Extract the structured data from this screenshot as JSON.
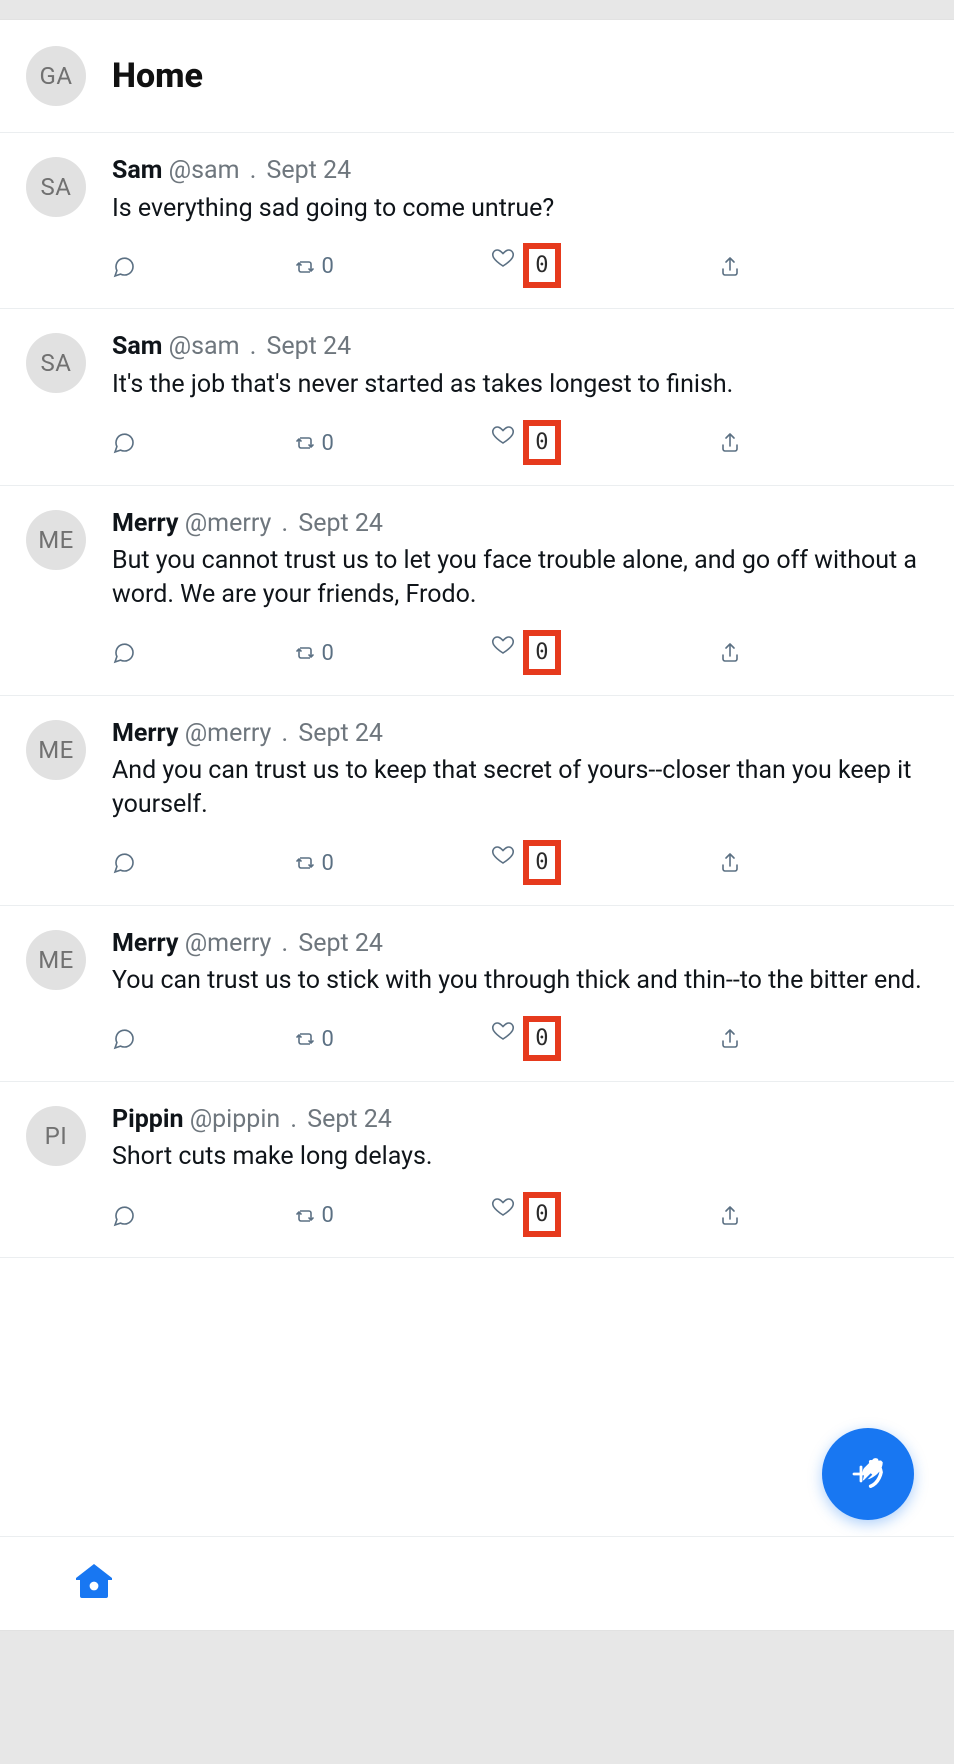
{
  "header": {
    "avatar_initials": "GA",
    "title": "Home"
  },
  "posts": [
    {
      "avatar": "SA",
      "name": "Sam",
      "handle": "@sam",
      "date": "Sept 24",
      "text": "Is everything sad going to come untrue?",
      "retweets": "0",
      "likes": "0"
    },
    {
      "avatar": "SA",
      "name": "Sam",
      "handle": "@sam",
      "date": "Sept 24",
      "text": "It's the job that's never started as takes longest to finish.",
      "retweets": "0",
      "likes": "0"
    },
    {
      "avatar": "ME",
      "name": "Merry",
      "handle": "@merry",
      "date": "Sept 24",
      "text": "But you cannot trust us to let you face trouble alone, and go off without a word. We are your friends, Frodo.",
      "retweets": "0",
      "likes": "0"
    },
    {
      "avatar": "ME",
      "name": "Merry",
      "handle": "@merry",
      "date": "Sept 24",
      "text": "And you can trust us to keep that secret of yours--closer than you keep it yourself.",
      "retweets": "0",
      "likes": "0"
    },
    {
      "avatar": "ME",
      "name": "Merry",
      "handle": "@merry",
      "date": "Sept 24",
      "text": "You can trust us to stick with you through thick and thin--to the bitter end.",
      "retweets": "0",
      "likes": "0"
    },
    {
      "avatar": "PI",
      "name": "Pippin",
      "handle": "@pippin",
      "date": "Sept 24",
      "text": "Short cuts make long delays.",
      "retweets": "0",
      "likes": "0"
    }
  ],
  "ui": {
    "separator": "."
  }
}
